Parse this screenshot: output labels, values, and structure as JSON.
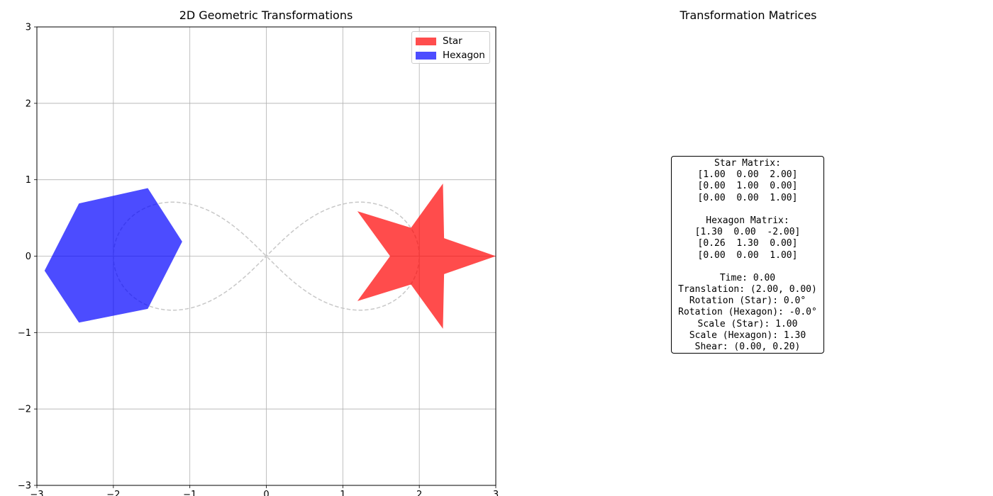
{
  "chart_data": [
    {
      "type": "scatter",
      "title": "2D Geometric Transformations",
      "xlim": [
        -3,
        3
      ],
      "ylim": [
        -3,
        3
      ],
      "xticks": [
        -3,
        -2,
        -1,
        0,
        1,
        2,
        3
      ],
      "yticks": [
        -3,
        -2,
        -1,
        0,
        1,
        2,
        3
      ],
      "xtick_labels": [
        "−3",
        "−2",
        "−1",
        "0",
        "1",
        "2",
        "3"
      ],
      "ytick_labels": [
        "−3",
        "−2",
        "−1",
        "0",
        "1",
        "2",
        "3"
      ],
      "grid": true,
      "legend_position": "top-right",
      "legend": [
        {
          "label": "Star",
          "color": "#ff4d4d"
        },
        {
          "label": "Hexagon",
          "color": "#4d4dff"
        }
      ],
      "shapes": [
        {
          "name": "Star",
          "color": "#ff0000",
          "alpha": 0.7,
          "points": [
            [
              3.0,
              0.0
            ],
            [
              2.324,
              0.235
            ],
            [
              2.309,
              0.951
            ],
            [
              1.891,
              0.371
            ],
            [
              1.191,
              0.588
            ],
            [
              1.618,
              0.0
            ],
            [
              1.191,
              -0.588
            ],
            [
              1.891,
              -0.371
            ],
            [
              2.309,
              -0.951
            ],
            [
              2.324,
              -0.235
            ]
          ]
        },
        {
          "name": "Hexagon",
          "color": "#0000ff",
          "alpha": 0.7,
          "points": [
            [
              -1.1,
              0.19
            ],
            [
              -1.55,
              0.89
            ],
            [
              -2.45,
              0.69
            ],
            [
              -2.9,
              -0.19
            ],
            [
              -2.45,
              -0.87
            ],
            [
              -1.55,
              -0.69
            ]
          ]
        }
      ],
      "path": {
        "style": "dashed",
        "color": "#c8c8c8",
        "description_points": "lemniscate x = 2cos(t)/(1+sin^2 t), y = 2sin(t)cos(t)/(1+sin^2 t)"
      }
    }
  ],
  "right_panel": {
    "title": "Transformation Matrices",
    "lines": [
      "Star Matrix:",
      "[1.00  0.00  2.00]",
      "[0.00  1.00  0.00]",
      "[0.00  0.00  1.00]",
      "",
      "Hexagon Matrix:",
      "[1.30  0.00  -2.00]",
      "[0.26  1.30  0.00]",
      "[0.00  0.00  1.00]",
      "",
      "Time: 0.00",
      "Translation: (2.00, 0.00)",
      "Rotation (Star): 0.0°",
      "Rotation (Hexagon): -0.0°",
      "Scale (Star): 1.00",
      "Scale (Hexagon): 1.30",
      "Shear: (0.00, 0.20)"
    ]
  }
}
